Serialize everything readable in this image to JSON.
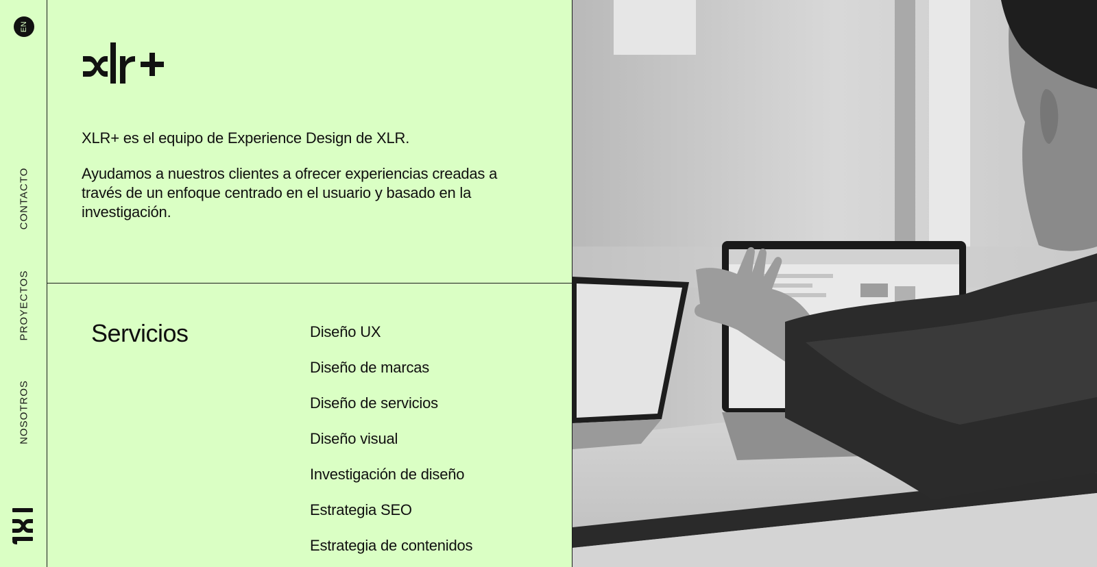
{
  "rail": {
    "language": "EN",
    "nav": [
      {
        "label": "CONTACTO"
      },
      {
        "label": "PROYECTOS"
      },
      {
        "label": "NOSOTROS"
      }
    ],
    "logo_text": "xlr"
  },
  "brand": {
    "logo_text": "xlr+"
  },
  "intro": {
    "line1": "XLR+ es el equipo de Experience Design de XLR.",
    "line2": "Ayudamos a nuestros clientes a ofrecer experiencias creadas a través de un enfoque centrado en el usuario y basado en la investigación."
  },
  "services": {
    "title": "Servicios",
    "items": [
      "Diseño UX",
      "Diseño de marcas",
      "Diseño de servicios",
      "Diseño visual",
      "Investigación de diseño",
      "Estrategia SEO",
      "Estrategia de contenidos"
    ]
  },
  "colors": {
    "background": "#daffc4",
    "ink": "#0f0f0f"
  }
}
